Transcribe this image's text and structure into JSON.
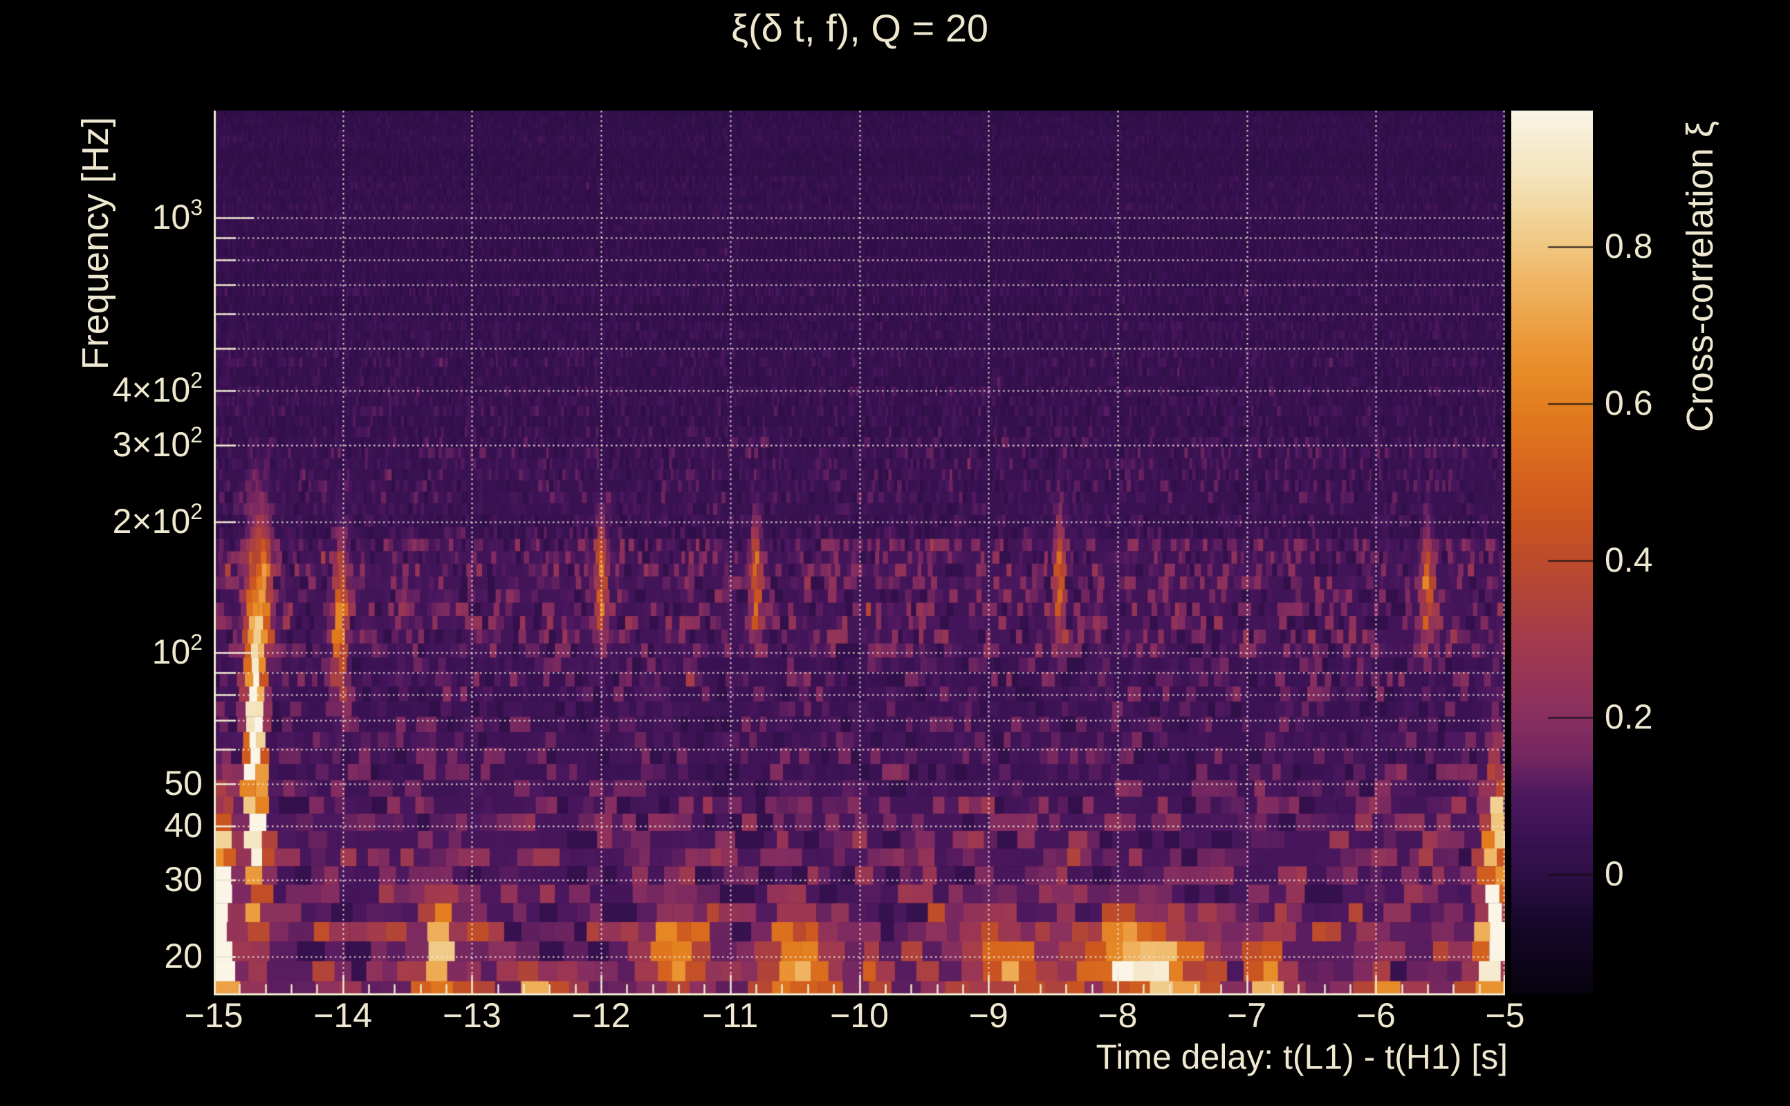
{
  "title": "ξ(δ t, f), Q = 20",
  "axes": {
    "x": {
      "title": "Time delay: t(L1) - t(H1) [s]",
      "min": -15,
      "max": -5,
      "ticks": [
        {
          "value": -15,
          "label": "−15"
        },
        {
          "value": -14,
          "label": "−14"
        },
        {
          "value": -13,
          "label": "−13"
        },
        {
          "value": -12,
          "label": "−12"
        },
        {
          "value": -11,
          "label": "−11"
        },
        {
          "value": -10,
          "label": "−10"
        },
        {
          "value": -9,
          "label": "−9"
        },
        {
          "value": -8,
          "label": "−8"
        },
        {
          "value": -7,
          "label": "−7"
        },
        {
          "value": -6,
          "label": "−6"
        },
        {
          "value": -5,
          "label": "−5"
        }
      ],
      "minor_step": 0.2
    },
    "y": {
      "title": "Frequency [Hz]",
      "scale": "log",
      "fmin": 16.3,
      "fmax": 1762,
      "ticks": [
        {
          "value": 1000,
          "main": "10",
          "sup": "3"
        },
        {
          "value": 400,
          "main": "4×10",
          "sup": "2"
        },
        {
          "value": 300,
          "main": "3×10",
          "sup": "2"
        },
        {
          "value": 200,
          "main": "2×10",
          "sup": "2"
        },
        {
          "value": 100,
          "main": "10",
          "sup": "2"
        },
        {
          "value": 50,
          "main": "50",
          "sup": ""
        },
        {
          "value": 40,
          "main": "40",
          "sup": ""
        },
        {
          "value": 30,
          "main": "30",
          "sup": ""
        },
        {
          "value": 20,
          "main": "20",
          "sup": ""
        }
      ]
    },
    "colorbar": {
      "title": "Cross-correlation ξ",
      "vmin": -0.152,
      "vmax": 0.974,
      "ticks": [
        {
          "value": 0.8,
          "label": "0.8"
        },
        {
          "value": 0.6,
          "label": "0.6"
        },
        {
          "value": 0.4,
          "label": "0.4"
        },
        {
          "value": 0.2,
          "label": "0.2"
        },
        {
          "value": 0.0,
          "label": "0"
        }
      ]
    }
  },
  "chart_data": {
    "type": "heatmap",
    "description": "Q-transform style cross-correlation spectrogram ξ(δt, f) with Q=20 between LIGO L1 and H1; log-frequency 16.3–1762 Hz vs time delay −15 to −5 s; mostly faint purple noise with bright yellow transient streaks near δt≈−14.7 s (30–150 Hz), at the left edge near −14.95 s (17–45 Hz), at the right edge near −5.05 s (20–45 Hz), and orange blobs along the ~17–23 Hz bottom rows.",
    "grid": {
      "freq_lines": [
        20,
        30,
        40,
        50,
        60,
        70,
        80,
        90,
        100,
        200,
        300,
        400,
        500,
        600,
        700,
        800,
        900,
        1000
      ],
      "time_lines": [
        -14,
        -13,
        -12,
        -11,
        -10,
        -9,
        -8,
        -7,
        -6,
        -5
      ],
      "decade_freqs": [
        100,
        1000
      ]
    },
    "colormap": {
      "stops": [
        {
          "v": -0.152,
          "c": "#07030E"
        },
        {
          "v": -0.05,
          "c": "#1A0930"
        },
        {
          "v": 0.0,
          "c": "#2E0F45"
        },
        {
          "v": 0.05,
          "c": "#3B1354"
        },
        {
          "v": 0.1,
          "c": "#4C185F"
        },
        {
          "v": 0.15,
          "c": "#742760"
        },
        {
          "v": 0.2,
          "c": "#882F60"
        },
        {
          "v": 0.25,
          "c": "#973556"
        },
        {
          "v": 0.3,
          "c": "#A33B4D"
        },
        {
          "v": 0.35,
          "c": "#B0433C"
        },
        {
          "v": 0.4,
          "c": "#BD4B2C"
        },
        {
          "v": 0.45,
          "c": "#CA5522"
        },
        {
          "v": 0.5,
          "c": "#D4611E"
        },
        {
          "v": 0.55,
          "c": "#DD6F1E"
        },
        {
          "v": 0.6,
          "c": "#E37F20"
        },
        {
          "v": 0.65,
          "c": "#E98E2B"
        },
        {
          "v": 0.7,
          "c": "#EDA044"
        },
        {
          "v": 0.75,
          "c": "#F0B35F"
        },
        {
          "v": 0.8,
          "c": "#F0C780"
        },
        {
          "v": 0.85,
          "c": "#F2D8A1"
        },
        {
          "v": 0.9,
          "c": "#F5E6C2"
        },
        {
          "v": 0.974,
          "c": "#FAF5E6"
        }
      ]
    },
    "texture": {
      "seed": 1337,
      "row_height": {
        "min": 9,
        "grow": 21,
        "pow": 1.2
      },
      "col_width": {
        "min": 2.5,
        "grow": 30,
        "pow": 2.6
      },
      "base": {
        "start": 0.015,
        "slope": 0.055
      },
      "amp": {
        "start": 0.05,
        "slope": 0.17,
        "pow": 1.6
      },
      "spike_prob": 0.012,
      "dark_prob": 0.1,
      "bands": [
        {
          "flo": 16,
          "fhi": 24,
          "base": 0.05,
          "amp": 0.1
        },
        {
          "flo": 25,
          "fhi": 48,
          "base": 0.02,
          "amp": 0.04
        },
        {
          "flo": 95,
          "fhi": 185,
          "base": 0.02,
          "amp": 0.07
        }
      ]
    },
    "features": [
      {
        "t": -14.68,
        "f": 60,
        "st": 0.05,
        "sf": 0.26,
        "amp": 1.15
      },
      {
        "t": -14.6,
        "f": 145,
        "st": 0.035,
        "sf": 0.1,
        "amp": 0.45
      },
      {
        "t": -14.93,
        "f": 26,
        "st": 0.055,
        "sf": 0.15,
        "amp": 1.0
      },
      {
        "t": -14.96,
        "f": 18,
        "st": 0.05,
        "sf": 0.05,
        "amp": 0.55
      },
      {
        "t": -14.02,
        "f": 115,
        "st": 0.035,
        "sf": 0.12,
        "amp": 0.55
      },
      {
        "t": -13.25,
        "f": 23,
        "st": 0.08,
        "sf": 0.07,
        "amp": 0.6
      },
      {
        "t": -13.3,
        "f": 17.3,
        "st": 0.06,
        "sf": 0.05,
        "amp": 0.5
      },
      {
        "t": -12.55,
        "f": 16.5,
        "st": 0.05,
        "sf": 0.04,
        "amp": 0.45
      },
      {
        "t": -12.0,
        "f": 148,
        "st": 0.03,
        "sf": 0.09,
        "amp": 0.48
      },
      {
        "t": -11.4,
        "f": 20,
        "st": 0.13,
        "sf": 0.06,
        "amp": 0.6
      },
      {
        "t": -10.45,
        "f": 19,
        "st": 0.16,
        "sf": 0.055,
        "amp": 0.65
      },
      {
        "t": -10.8,
        "f": 150,
        "st": 0.03,
        "sf": 0.09,
        "amp": 0.42
      },
      {
        "t": -9.9,
        "f": 16.5,
        "st": 0.05,
        "sf": 0.04,
        "amp": 0.5
      },
      {
        "t": -9.0,
        "f": 21,
        "st": 0.1,
        "sf": 0.06,
        "amp": 0.45
      },
      {
        "t": -8.75,
        "f": 18,
        "st": 0.08,
        "sf": 0.05,
        "amp": 0.5
      },
      {
        "t": -8.45,
        "f": 150,
        "st": 0.03,
        "sf": 0.09,
        "amp": 0.42
      },
      {
        "t": -7.8,
        "f": 19.5,
        "st": 0.33,
        "sf": 0.06,
        "amp": 0.7
      },
      {
        "t": -6.85,
        "f": 17.5,
        "st": 0.06,
        "sf": 0.045,
        "amp": 0.5
      },
      {
        "t": -6.0,
        "f": 16.5,
        "st": 0.06,
        "sf": 0.045,
        "amp": 0.5
      },
      {
        "t": -5.6,
        "f": 140,
        "st": 0.03,
        "sf": 0.09,
        "amp": 0.45
      },
      {
        "t": -5.07,
        "f": 29,
        "st": 0.05,
        "sf": 0.17,
        "amp": 1.05
      },
      {
        "t": -5.12,
        "f": 20,
        "st": 0.07,
        "sf": 0.06,
        "amp": 0.55
      }
    ]
  },
  "colors": {
    "background": "#000000",
    "text": "#EFE8D1",
    "axis": "#EFE8D0",
    "gridline": "#F4EEDC"
  }
}
